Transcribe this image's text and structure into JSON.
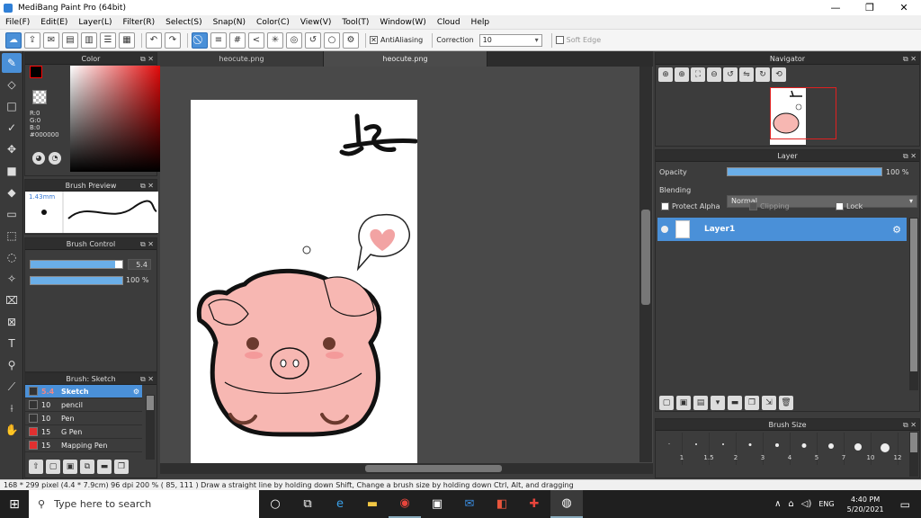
{
  "window": {
    "title": "MediBang Paint Pro (64bit)",
    "min": "—",
    "restore": "❐",
    "close": "✕"
  },
  "menu": [
    "File(F)",
    "Edit(E)",
    "Layer(L)",
    "Filter(R)",
    "Select(S)",
    "Snap(N)",
    "Color(C)",
    "View(V)",
    "Tool(T)",
    "Window(W)",
    "Cloud",
    "Help"
  ],
  "toolbar": {
    "antialiasing": "AntiAliasing",
    "correction_label": "Correction",
    "correction_value": "10",
    "soft_edge": "Soft Edge"
  },
  "color_panel": {
    "title": "Color",
    "rgb_r": "R:0",
    "rgb_g": "G:0",
    "rgb_b": "B:0",
    "hex": "#000000",
    "fg_color": "#000000",
    "bg_color": "#dd0000"
  },
  "brush_preview": {
    "title": "Brush Preview",
    "size": "1.43mm"
  },
  "brush_control": {
    "title": "Brush Control",
    "size_value": "5.4",
    "size_fraction": 0.92,
    "opacity_value": "100 %",
    "opacity_fraction": 1.0
  },
  "brush_list": {
    "title": "Brush: Sketch",
    "items": [
      {
        "size": "5.4",
        "name": "Sketch",
        "color": "#333333",
        "selected": true
      },
      {
        "size": "10",
        "name": "pencil",
        "color": "#333333",
        "selected": false
      },
      {
        "size": "10",
        "name": "Pen",
        "color": "#333333",
        "selected": false
      },
      {
        "size": "15",
        "name": "G Pen",
        "color": "#e03030",
        "selected": false
      },
      {
        "size": "15",
        "name": "Mapping Pen",
        "color": "#e03030",
        "selected": false
      }
    ]
  },
  "tabs": [
    {
      "label": "heocute.png",
      "active": false
    },
    {
      "label": "heocute.png",
      "active": true
    }
  ],
  "navigator": {
    "title": "Navigator"
  },
  "layer_panel": {
    "title": "Layer",
    "opacity_label": "Opacity",
    "opacity_value": "100 %",
    "opacity_fraction": 1.0,
    "blending_label": "Blending",
    "blending_value": "Normal",
    "protect_alpha": "Protect Alpha",
    "clipping": "Clipping",
    "lock": "Lock",
    "layers": [
      {
        "name": "Layer1"
      }
    ]
  },
  "brush_size_panel": {
    "title": "Brush Size",
    "sizes": [
      "1",
      "1.5",
      "2",
      "3",
      "4",
      "5",
      "7",
      "10",
      "12"
    ]
  },
  "status": {
    "text": "168 * 299 pixel   (4.4 * 7.9cm)   96 dpi   200 %   ( 85, 111 )   Draw a straight line by holding down Shift, Change a brush size by holding down Ctrl, Alt, and dragging"
  },
  "taskbar": {
    "search_placeholder": "Type here to search",
    "lang": "ENG",
    "time": "4:40 PM",
    "date": "5/20/2021"
  }
}
